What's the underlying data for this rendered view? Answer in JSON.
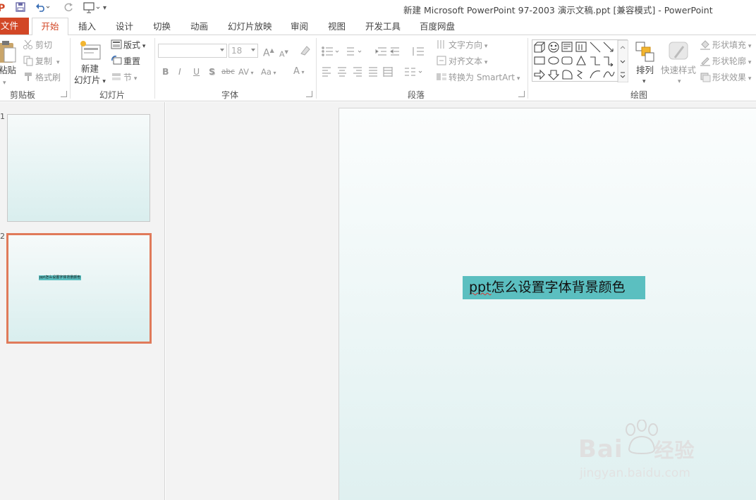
{
  "window": {
    "title": "新建 Microsoft PowerPoint 97-2003 演示文稿.ppt [兼容模式] - PowerPoint"
  },
  "tabs": [
    {
      "label": "文件"
    },
    {
      "label": "开始"
    },
    {
      "label": "插入"
    },
    {
      "label": "设计"
    },
    {
      "label": "切换"
    },
    {
      "label": "动画"
    },
    {
      "label": "幻灯片放映"
    },
    {
      "label": "审阅"
    },
    {
      "label": "视图"
    },
    {
      "label": "开发工具"
    },
    {
      "label": "百度网盘"
    }
  ],
  "ribbon": {
    "clipboard": {
      "paste_label": "粘贴",
      "cut_label": "剪切",
      "copy_label": "复制",
      "format_painter_label": "格式刷",
      "group_label": "剪贴板"
    },
    "slides": {
      "new_slide_line1": "新建",
      "new_slide_line2": "幻灯片",
      "layout_label": "版式",
      "reset_label": "重置",
      "section_label": "节",
      "group_label": "幻灯片"
    },
    "font": {
      "font_size": "18",
      "bold": "B",
      "italic": "I",
      "underline": "U",
      "shadow": "S",
      "strike": "abc",
      "spacing": "AV",
      "case": "Aa",
      "color": "A",
      "grow": "A",
      "shrink": "A",
      "group_label": "字体"
    },
    "paragraph": {
      "text_direction_label": "文字方向",
      "align_text_label": "对齐文本",
      "smartart_label": "转换为 SmartArt",
      "group_label": "段落"
    },
    "drawing": {
      "arrange_label": "排列",
      "quick_styles_label": "快速样式",
      "shape_fill_label": "形状填充",
      "shape_outline_label": "形状轮廓",
      "shape_effects_label": "形状效果",
      "group_label": "绘图"
    }
  },
  "thumbnails": [
    {
      "number": "1",
      "selected": false,
      "text": ""
    },
    {
      "number": "2",
      "selected": true,
      "text": "ppt怎么设置字体背景颜色"
    }
  ],
  "slide": {
    "text_latin": "ppt",
    "text_cjk": "怎么设置字体背景颜色",
    "highlight_color": "#5bbfc0"
  },
  "watermark": {
    "brand": "Bai",
    "brand_suffix": "经验",
    "url": "jingyan.baidu.com"
  },
  "colors": {
    "accent": "#d24726",
    "selection": "#e07a5a"
  }
}
